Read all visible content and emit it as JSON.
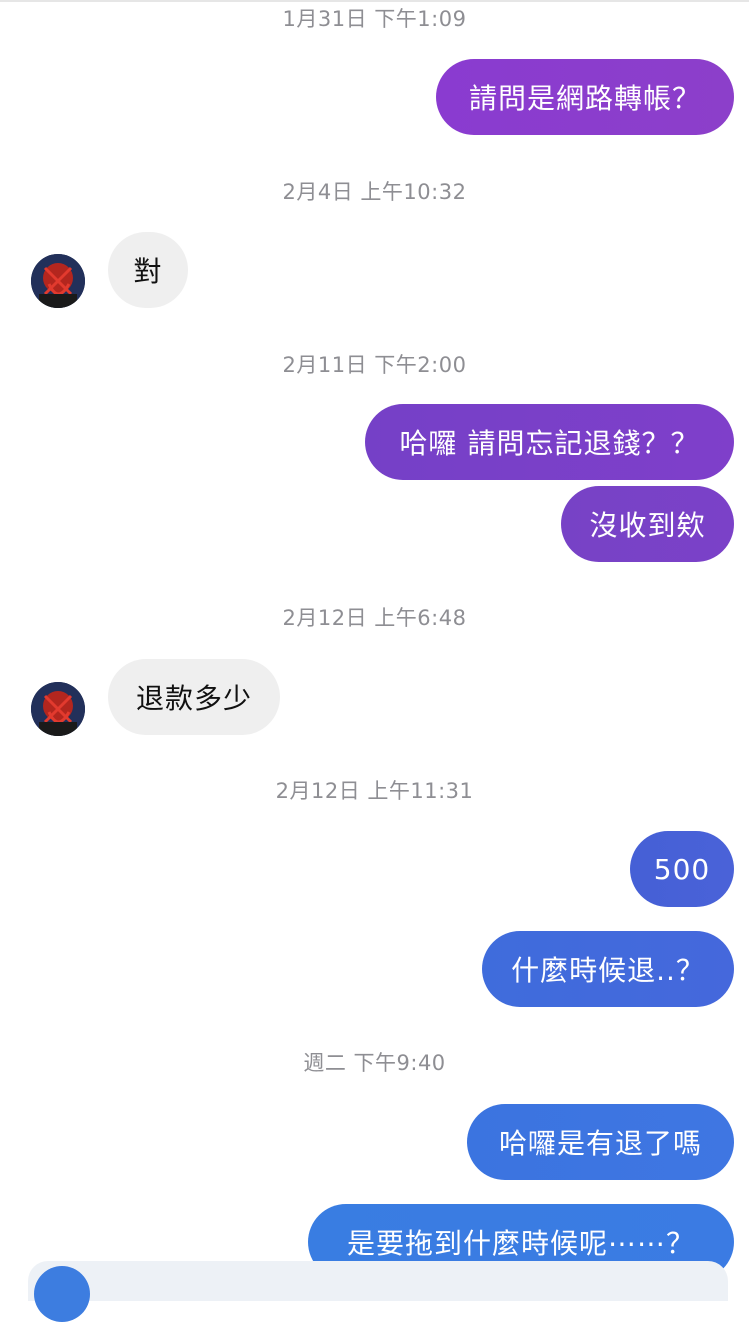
{
  "colors": {
    "bubble_purple_start": "#7a3fc8",
    "bubble_purple_end": "#8b3ec9",
    "bubble_blue_start": "#3d6fdc",
    "bubble_blue_end": "#3f78e3",
    "bubble_gray": "#efefef",
    "timestamp_gray": "#8e8e93"
  },
  "messages": [
    {
      "type": "timestamp",
      "text": "1月31日 下午1:09"
    },
    {
      "type": "outgoing",
      "text": "請問是網路轉帳？"
    },
    {
      "type": "timestamp",
      "text": "2月4日 上午10:32"
    },
    {
      "type": "incoming",
      "text": "對"
    },
    {
      "type": "timestamp",
      "text": "2月11日 下午2:00"
    },
    {
      "type": "outgoing",
      "text": "哈囉 請問忘記退錢？？"
    },
    {
      "type": "outgoing",
      "text": "沒收到欸"
    },
    {
      "type": "timestamp",
      "text": "2月12日 上午6:48"
    },
    {
      "type": "incoming",
      "text": "退款多少"
    },
    {
      "type": "timestamp",
      "text": "2月12日 上午11:31"
    },
    {
      "type": "outgoing",
      "text": "500"
    },
    {
      "type": "outgoing",
      "text": "什麼時候退..？"
    },
    {
      "type": "timestamp",
      "text": "週二 下午9:40"
    },
    {
      "type": "outgoing",
      "text": "哈囉是有退了嗎"
    },
    {
      "type": "outgoing",
      "text": "是要拖到什麼時候呢⋯⋯？"
    }
  ]
}
